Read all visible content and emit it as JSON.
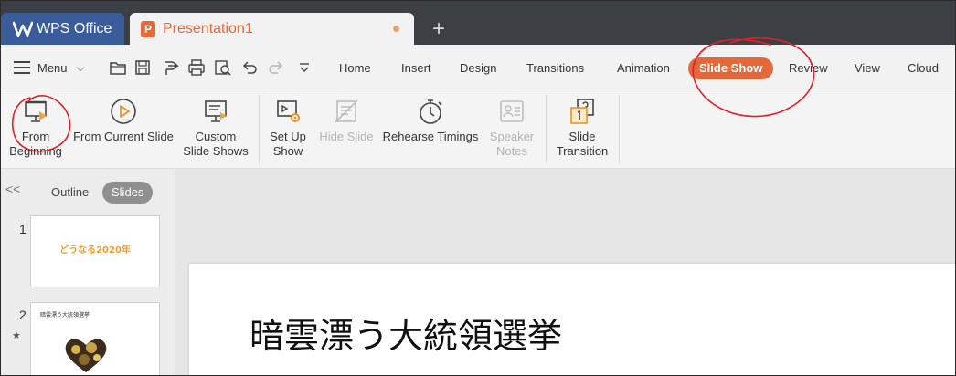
{
  "titlebar": {
    "app_tab": "WPS Office",
    "doc_tab": "Presentation1",
    "doc_icon_letter": "P",
    "new_tab_symbol": "+"
  },
  "menubar": {
    "menu_label": "Menu",
    "tabs": [
      "Home",
      "Insert",
      "Design",
      "Transitions",
      "Animation",
      "Slide Show",
      "Review",
      "View",
      "Cloud"
    ],
    "active_tab": "Slide Show",
    "accent_color": "#e5683a"
  },
  "ribbon": {
    "buttons": [
      {
        "label": "From\nBeginning",
        "icon": "monitor-play-icon",
        "enabled": true
      },
      {
        "label": "From Current Slide",
        "icon": "play-circle-icon",
        "enabled": true
      },
      {
        "label": "Custom\nSlide Shows",
        "icon": "custom-show-icon",
        "enabled": true
      },
      {
        "label": "Set Up\nShow",
        "icon": "setup-show-icon",
        "enabled": true
      },
      {
        "label": "Hide Slide",
        "icon": "hide-slide-icon",
        "enabled": false
      },
      {
        "label": "Rehearse Timings",
        "icon": "stopwatch-icon",
        "enabled": true
      },
      {
        "label": "Speaker\nNotes",
        "icon": "speaker-notes-icon",
        "enabled": false
      },
      {
        "label": "Slide\nTransition",
        "icon": "slide-transition-icon",
        "enabled": true
      }
    ]
  },
  "panel": {
    "collapse_symbol": "<<",
    "tabs": [
      "Outline",
      "Slides"
    ],
    "active_tab": "Slides",
    "slides": [
      {
        "number": "1",
        "title": "どうなる2020年"
      },
      {
        "number": "2",
        "title": "暗雲漂う大統領選挙",
        "has_animation_star": "★"
      }
    ]
  },
  "slide": {
    "title": "暗雲漂う大統領選挙"
  },
  "annotation_color": "#e0202a"
}
